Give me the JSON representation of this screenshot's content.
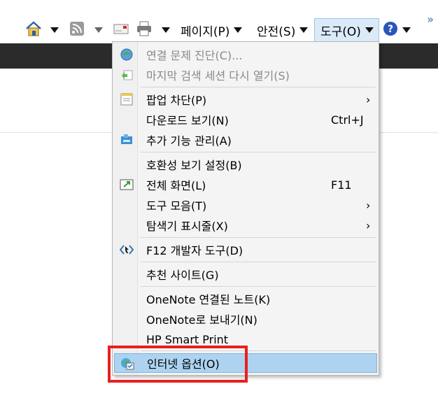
{
  "toolbar": {
    "page_label": "페이지(P)",
    "safety_label": "안전(S)",
    "tools_label": "도구(O)",
    "icons": [
      "home-icon",
      "rss-icon",
      "mail-icon",
      "print-icon",
      "help-icon"
    ],
    "overflow_glyph": "»"
  },
  "menu": {
    "items": [
      {
        "label": "연결 문제 진단(C)...",
        "shortcut": "",
        "submenu": false,
        "disabled": true,
        "icon": "network-diagnose-icon"
      },
      {
        "label": "마지막 검색 세션 다시 열기(S)",
        "shortcut": "",
        "submenu": false,
        "disabled": true,
        "icon": "reopen-session-icon"
      },
      {
        "label": "팝업 차단(P)",
        "shortcut": "",
        "submenu": true,
        "disabled": false,
        "icon": "popup-blocker-icon"
      },
      {
        "label": "다운로드 보기(N)",
        "shortcut": "Ctrl+J",
        "submenu": false,
        "disabled": false,
        "icon": ""
      },
      {
        "label": "추가 기능 관리(A)",
        "shortcut": "",
        "submenu": false,
        "disabled": false,
        "icon": "addons-icon"
      },
      {
        "label": "호환성 보기 설정(B)",
        "shortcut": "",
        "submenu": false,
        "disabled": false,
        "icon": ""
      },
      {
        "label": "전체 화면(L)",
        "shortcut": "F11",
        "submenu": false,
        "disabled": false,
        "icon": "fullscreen-icon"
      },
      {
        "label": "도구 모음(T)",
        "shortcut": "",
        "submenu": true,
        "disabled": false,
        "icon": ""
      },
      {
        "label": "탐색기 표시줄(X)",
        "shortcut": "",
        "submenu": true,
        "disabled": false,
        "icon": ""
      },
      {
        "label": "F12 개발자 도구(D)",
        "shortcut": "",
        "submenu": false,
        "disabled": false,
        "icon": "devtools-icon"
      },
      {
        "label": "추천 사이트(G)",
        "shortcut": "",
        "submenu": false,
        "disabled": false,
        "icon": ""
      },
      {
        "label": "OneNote 연결된 노트(K)",
        "shortcut": "",
        "submenu": false,
        "disabled": false,
        "icon": ""
      },
      {
        "label": "OneNote로 보내기(N)",
        "shortcut": "",
        "submenu": false,
        "disabled": false,
        "icon": ""
      },
      {
        "label": "HP Smart Print",
        "shortcut": "",
        "submenu": false,
        "disabled": false,
        "icon": ""
      },
      {
        "label": "인터넷 옵션(O)",
        "shortcut": "",
        "submenu": false,
        "disabled": false,
        "icon": "internet-options-icon",
        "highlighted": true
      }
    ],
    "submenu_glyph": "›"
  },
  "colors": {
    "highlight": "#add3f0",
    "annotation_red": "#e8201e",
    "dark_bar": "#2b2b2b"
  }
}
